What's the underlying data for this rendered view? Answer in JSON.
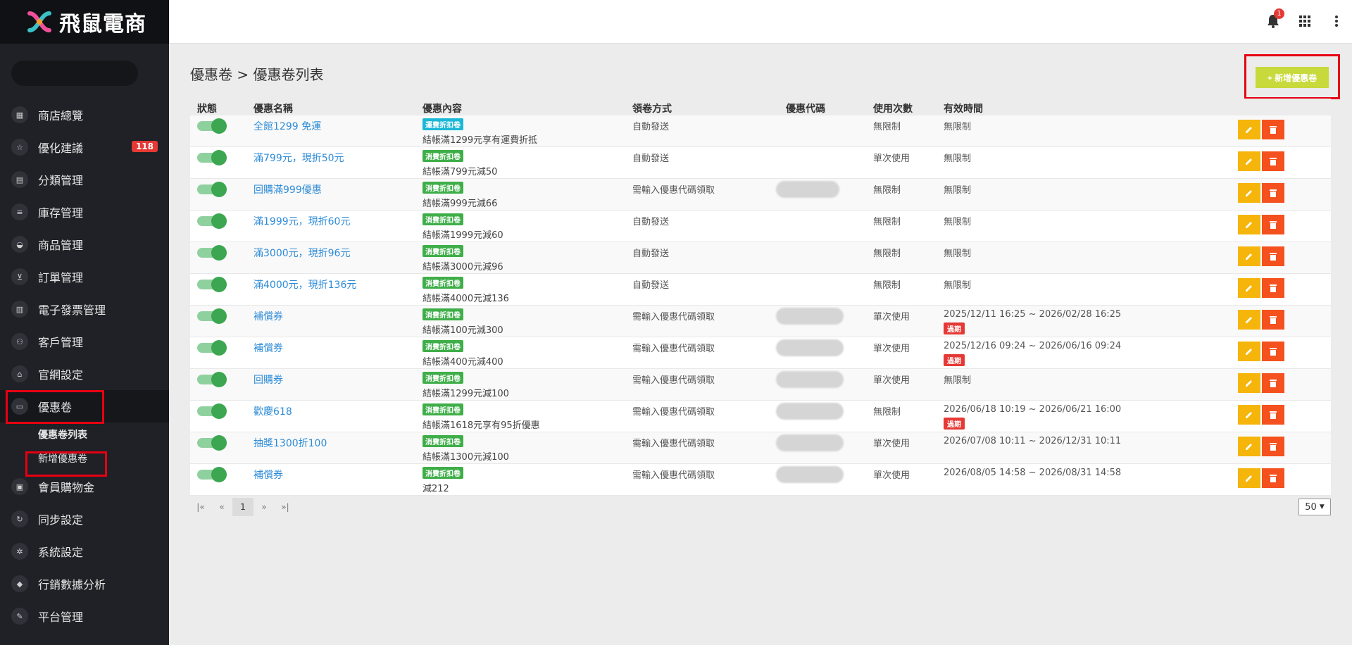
{
  "brand": {
    "name": "飛鼠電商"
  },
  "sidebar": {
    "items": [
      {
        "label": "商店總覽",
        "icon": "dashboard-icon"
      },
      {
        "label": "優化建議",
        "icon": "star-icon",
        "badge": "118"
      },
      {
        "label": "分類管理",
        "icon": "folder-icon"
      },
      {
        "label": "庫存管理",
        "icon": "list-icon"
      },
      {
        "label": "商品管理",
        "icon": "basket-icon"
      },
      {
        "label": "訂單管理",
        "icon": "cart-icon"
      },
      {
        "label": "電子發票管理",
        "icon": "invoice-icon"
      },
      {
        "label": "客戶管理",
        "icon": "people-icon"
      },
      {
        "label": "官網設定",
        "icon": "home-icon"
      },
      {
        "label": "優惠卷",
        "icon": "ticket-icon"
      }
    ],
    "sub_items": [
      {
        "label": "優惠卷列表"
      },
      {
        "label": "新增優惠卷"
      }
    ],
    "items_after": [
      {
        "label": "會員購物金",
        "icon": "wallet-icon"
      },
      {
        "label": "同步設定",
        "icon": "sync-icon"
      },
      {
        "label": "系統設定",
        "icon": "gear-icon"
      },
      {
        "label": "行銷數據分析",
        "icon": "analytics-icon"
      },
      {
        "label": "平台管理",
        "icon": "tools-icon"
      }
    ]
  },
  "topbar": {
    "notification_count": "1"
  },
  "page": {
    "breadcrumb": "優惠卷 > 優惠卷列表",
    "add_button": "+ 新增優惠卷"
  },
  "table": {
    "headers": [
      "狀態",
      "優惠名稱",
      "優惠內容",
      "領卷方式",
      "優惠代碼",
      "使用次數",
      "有效時間"
    ],
    "rows": [
      {
        "name": "全館1299 免運",
        "tag": "運費折扣卷",
        "desc": "結帳滿1299元享有運費折抵",
        "method": "自動發送",
        "code": false,
        "uses": "無限制",
        "valid": "無限制",
        "expired": ""
      },
      {
        "name": "滿799元，現折50元",
        "tag": "消費折扣卷",
        "desc": "結帳滿799元減50",
        "method": "自動發送",
        "code": false,
        "uses": "單次使用",
        "valid": "無限制",
        "expired": ""
      },
      {
        "name": "回購滿999優惠",
        "tag": "消費折扣卷",
        "desc": "結帳滿999元減66",
        "method": "需輸入優惠代碼領取",
        "code": true,
        "uses": "無限制",
        "valid": "無限制",
        "expired": ""
      },
      {
        "name": "滿1999元，現折60元",
        "tag": "消費折扣卷",
        "desc": "結帳滿1999元減60",
        "method": "自動發送",
        "code": false,
        "uses": "無限制",
        "valid": "無限制",
        "expired": ""
      },
      {
        "name": "滿3000元，現折96元",
        "tag": "消費折扣卷",
        "desc": "結帳滿3000元減96",
        "method": "自動發送",
        "code": false,
        "uses": "無限制",
        "valid": "無限制",
        "expired": ""
      },
      {
        "name": "滿4000元，現折136元",
        "tag": "消費折扣卷",
        "desc": "結帳滿4000元減136",
        "method": "自動發送",
        "code": false,
        "uses": "無限制",
        "valid": "無限制",
        "expired": ""
      },
      {
        "name": "補償券",
        "tag": "消費折扣卷",
        "desc": "結帳滿100元減300",
        "method": "需輸入優惠代碼領取",
        "code": true,
        "uses": "單次使用",
        "valid": "2025/12/11 16:25 ~ 2026/02/28 16:25",
        "expired": "過期"
      },
      {
        "name": "補償券",
        "tag": "消費折扣卷",
        "desc": "結帳滿400元減400",
        "method": "需輸入優惠代碼領取",
        "code": true,
        "uses": "單次使用",
        "valid": "2025/12/16 09:24 ~ 2026/06/16 09:24",
        "expired": "過期"
      },
      {
        "name": "回購券",
        "tag": "消費折扣卷",
        "desc": "結帳滿1299元減100",
        "method": "需輸入優惠代碼領取",
        "code": true,
        "uses": "單次使用",
        "valid": "無限制",
        "expired": ""
      },
      {
        "name": "歡慶618",
        "tag": "消費折扣卷",
        "desc": "結帳滿1618元享有95折優惠",
        "method": "需輸入優惠代碼領取",
        "code": true,
        "uses": "無限制",
        "valid": "2026/06/18 10:19 ~ 2026/06/21 16:00",
        "expired": "過期"
      },
      {
        "name": "抽獎1300折100",
        "tag": "消費折扣卷",
        "desc": "結帳滿1300元減100",
        "method": "需輸入優惠代碼領取",
        "code": true,
        "uses": "單次使用",
        "valid": "2026/07/08 10:11 ~ 2026/12/31 10:11",
        "expired": ""
      },
      {
        "name": "補償券",
        "tag": "消費折扣卷",
        "desc": "減212",
        "method": "需輸入優惠代碼領取",
        "code": true,
        "uses": "單次使用",
        "valid": "2026/08/05 14:58 ~ 2026/08/31 14:58",
        "expired": ""
      }
    ]
  },
  "pagination": {
    "first": "|«",
    "prev": "«",
    "current": "1",
    "next": "»",
    "last": "»|",
    "per_page": "50"
  },
  "colors": {
    "accent": "#c7d93b",
    "link": "#2d8bd7",
    "toggle_on": "#3ca651",
    "edit": "#f5b50a",
    "delete": "#f4511e"
  }
}
